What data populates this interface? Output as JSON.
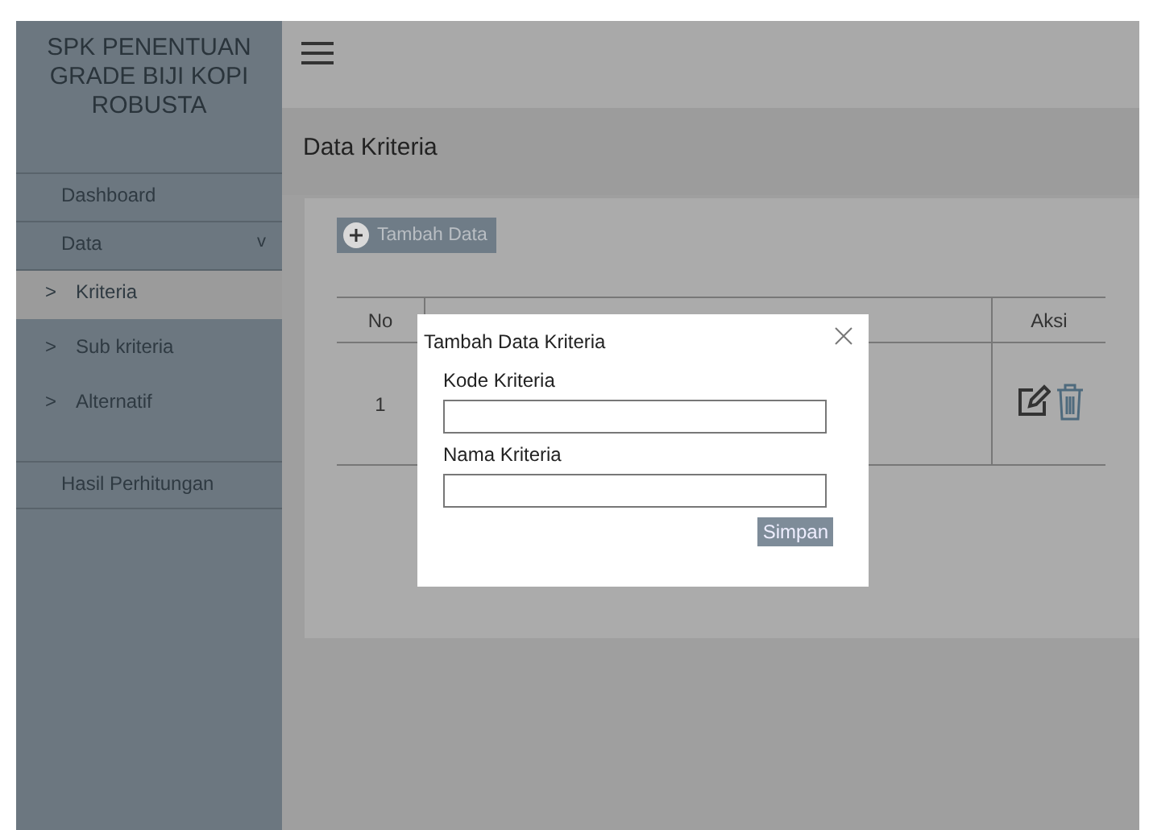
{
  "sidebar": {
    "title": "SPK PENENTUAN GRADE BIJI KOPI ROBUSTA",
    "items": [
      {
        "label": "Dashboard",
        "selected": false
      },
      {
        "label": "Data",
        "selected": false,
        "expanded": true,
        "toggle": "v",
        "children": [
          {
            "label": "Kriteria",
            "marker": ">",
            "selected": true
          },
          {
            "label": "Sub kriteria",
            "marker": ">",
            "selected": false
          },
          {
            "label": "Alternatif",
            "marker": ">",
            "selected": false
          }
        ]
      },
      {
        "label": "Hasil Perhitungan",
        "selected": false
      }
    ]
  },
  "page_title": "Data Kriteria",
  "add_button": {
    "label": "Tambah Data"
  },
  "table": {
    "columns": [
      "No",
      "Aksi"
    ],
    "rows": [
      {
        "no": "1"
      }
    ]
  },
  "modal": {
    "title": "Tambah Data Kriteria",
    "fields": [
      {
        "label": "Kode Kriteria"
      },
      {
        "label": "Nama Kriteria"
      }
    ],
    "submit": "Simpan"
  }
}
